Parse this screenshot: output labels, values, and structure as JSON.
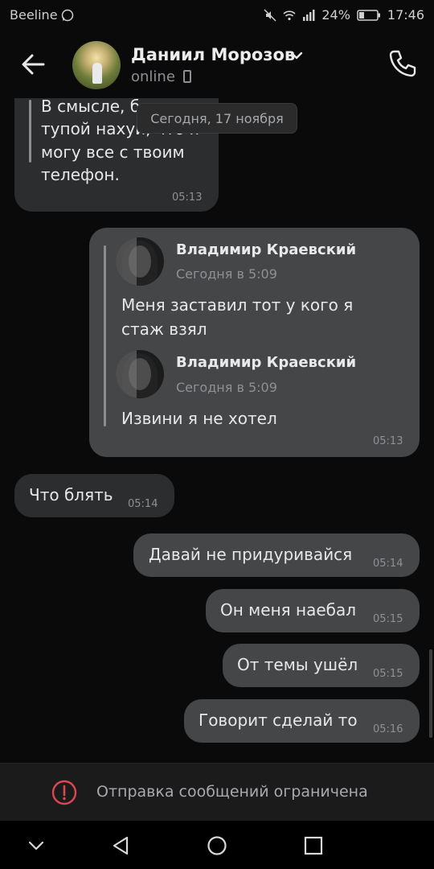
{
  "status_bar": {
    "carrier": "Beeline",
    "battery": "24%",
    "time": "17:46"
  },
  "header": {
    "contact_name": "Даниил Морозов",
    "status": "online"
  },
  "date_separator": "Сегодня, 17 ноября",
  "messages": [
    {
      "direction": "in",
      "lines": [
        "В смысле, блять",
        "тупой нахуй, что я",
        "могу все с твоим",
        "телефон."
      ],
      "time": "05:13"
    },
    {
      "direction": "out",
      "forwarded": [
        {
          "author": "Владимир Краевский",
          "date": "Сегодня в 5:09",
          "lines": [
            "Меня заставил тот у кого я",
            "стаж взял"
          ]
        },
        {
          "author": "Владимир Краевский",
          "date": "Сегодня в 5:09",
          "lines": [
            "Извини я не хотел"
          ]
        }
      ],
      "time": "05:13"
    },
    {
      "direction": "in",
      "text": "Что блять",
      "time": "05:14"
    },
    {
      "direction": "out",
      "text": "Давай не придуривайся",
      "time": "05:14"
    },
    {
      "direction": "out",
      "text": "Он меня наебал",
      "time": "05:15"
    },
    {
      "direction": "out",
      "text": "От темы ушёл",
      "time": "05:15"
    },
    {
      "direction": "out",
      "text": "Говорит сделай то",
      "time": "05:16"
    }
  ],
  "footer": {
    "restriction_text": "Отправка сообщений ограничена"
  },
  "icons": {
    "back": "arrow-left-icon",
    "chevron": "chevron-down-icon",
    "call": "phone-icon",
    "restriction": "alert-circle-icon",
    "nav": [
      "chevron-down-icon",
      "nav-back-icon",
      "nav-home-icon",
      "nav-recents-icon"
    ]
  },
  "colors": {
    "background": "#0a0a0a",
    "incoming_bubble": "#2c2d2e",
    "outgoing_bubble": "#454647",
    "alert": "#e0464e"
  }
}
